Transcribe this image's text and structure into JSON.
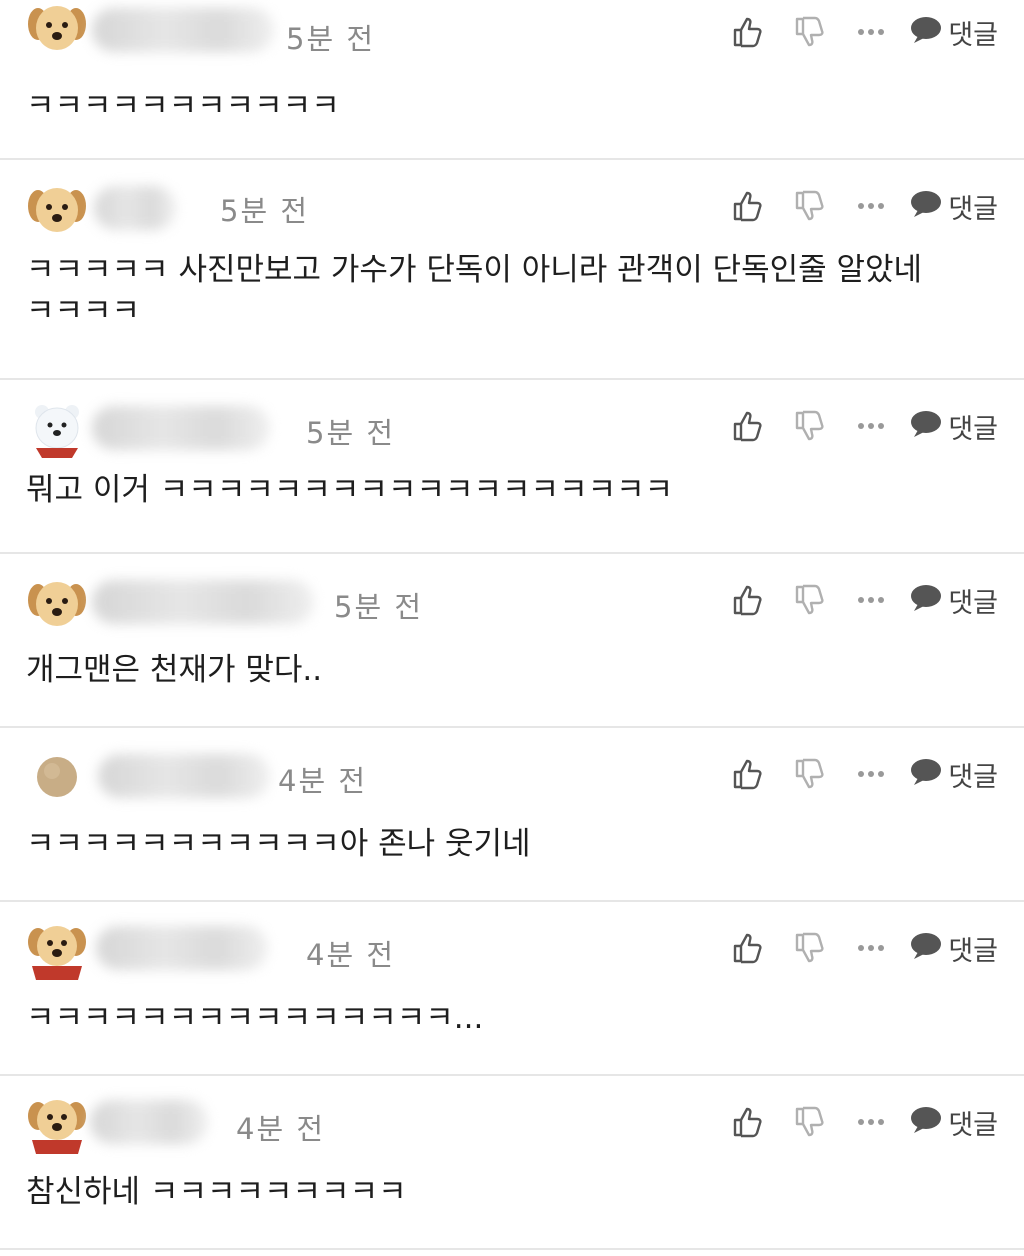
{
  "comments": [
    {
      "avatar": "puppy-avatar",
      "time": "5분 전",
      "text": "ㅋㅋㅋㅋㅋㅋㅋㅋㅋㅋㅋ"
    },
    {
      "avatar": "puppy-avatar",
      "time": "5분 전",
      "text": "ㅋㅋㅋㅋㅋ 사진만보고 가수가 단독이 아니라 관객이 단독인줄 알았네 ㅋㅋㅋㅋ"
    },
    {
      "avatar": "polar-bear-avatar",
      "time": "5분 전",
      "text": "뭐고 이거 ㅋㅋㅋㅋㅋㅋㅋㅋㅋㅋㅋㅋㅋㅋㅋㅋㅋㅋ"
    },
    {
      "avatar": "puppy-avatar",
      "time": "5분 전",
      "text": "개그맨은 천재가 맞다.."
    },
    {
      "avatar": "beige-circle-avatar",
      "time": "4분 전",
      "text": "ㅋㅋㅋㅋㅋㅋㅋㅋㅋㅋㅋ아 존나 웃기네"
    },
    {
      "avatar": "puppy-red-cape-avatar",
      "time": "4분 전",
      "text": "ㅋㅋㅋㅋㅋㅋㅋㅋㅋㅋㅋㅋㅋㅋㅋ..."
    },
    {
      "avatar": "puppy-red-cape-avatar",
      "time": "4분 전",
      "text": "참신하네 ㅋㅋㅋㅋㅋㅋㅋㅋㅋ"
    }
  ],
  "labels": {
    "reply": "댓글"
  },
  "icons": {
    "like": "thumbs-up-icon",
    "dislike": "thumbs-down-icon",
    "more": "more-dots-icon",
    "reply": "speech-bubble-icon"
  },
  "colors": {
    "time": "#8a8a8a",
    "divider": "#e6e6e6",
    "icon": "#555555",
    "dislike": "#b0b0b0"
  }
}
